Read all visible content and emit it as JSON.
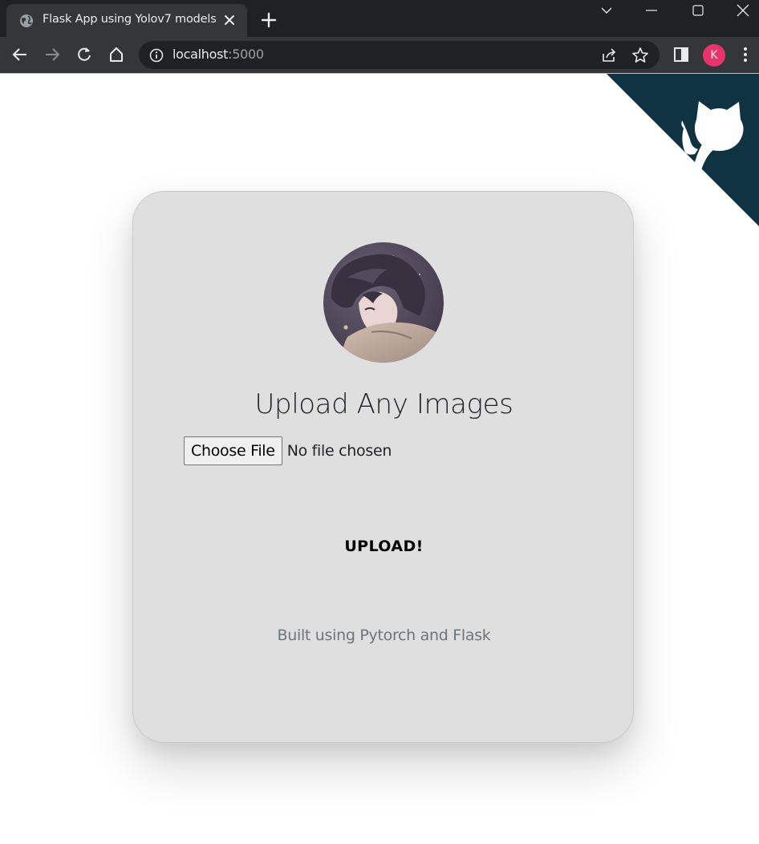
{
  "browser": {
    "tab_title": "Flask App using Yolov7 models",
    "url_host": "localhost",
    "url_port": ":5000",
    "profile_initial": "K",
    "profile_color": "#e8336d"
  },
  "icons": {
    "favicon": "globe-icon",
    "tab_close": "close-icon",
    "new_tab": "plus-icon",
    "back": "arrow-left-icon",
    "forward": "arrow-right-icon",
    "reload": "reload-icon",
    "home": "home-icon",
    "site_info": "info-icon",
    "share": "share-icon",
    "bookmark": "star-icon",
    "side_panel": "side-panel-icon",
    "menu": "kebab-menu-icon",
    "github": "github-octocat-icon"
  },
  "colors": {
    "chrome_dark": "#202124",
    "chrome_toolbar": "#35363a",
    "github_corner": "#0f3340",
    "card_bg": "#dfdfdf"
  },
  "card": {
    "title": "Upload Any Images",
    "choose_file_label": "Choose File",
    "file_status": "No file chosen",
    "upload_label": "UPLOAD!",
    "credit": "Built using Pytorch and Flask"
  }
}
